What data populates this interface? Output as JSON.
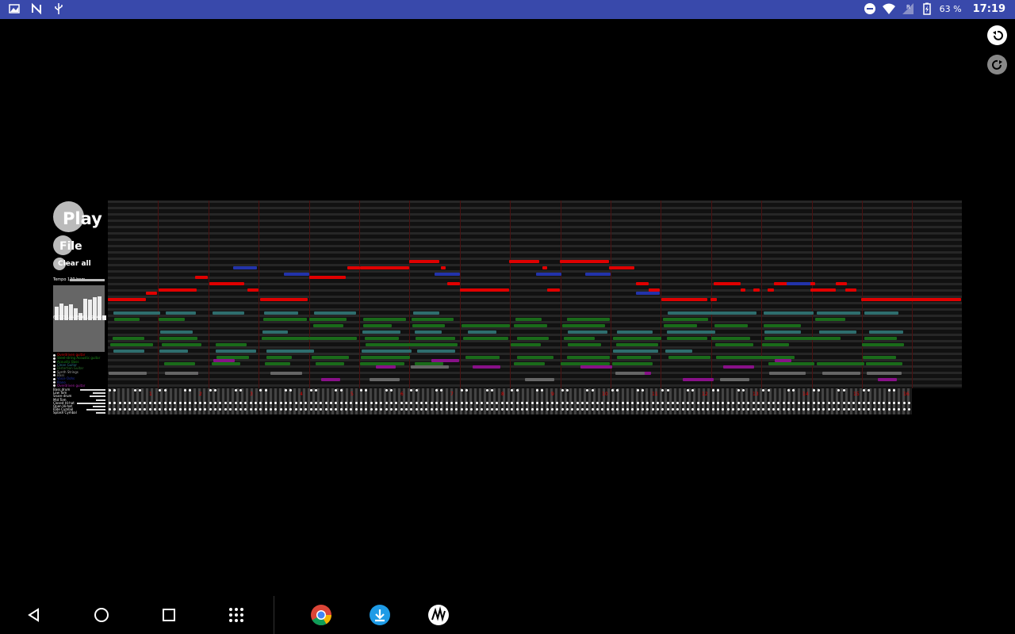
{
  "status_bar": {
    "time": "17:19",
    "battery": "63 %",
    "left_icons": [
      "image-icon",
      "n-icon",
      "usb-icon"
    ],
    "right_icons": [
      "dnd-icon",
      "wifi-icon",
      "signal-icon",
      "battery-icon"
    ]
  },
  "toolbar": {
    "play_label": "Play",
    "file_label": "File",
    "clear_label": "Clear all",
    "undo_icon": "undo-icon",
    "redo_icon": "redo-icon"
  },
  "tempo": {
    "label": "Tempo 130 bpm",
    "ticks": "65 123 144 28 46 1k 2k 4k 8k 16",
    "bar_levels": [
      0.55,
      0.7,
      0.6,
      0.65,
      0.5,
      0.3,
      0.9,
      0.85,
      0.95,
      1.0,
      0.2
    ]
  },
  "tracks": [
    {
      "name": "Overdriven guitar",
      "color": "#e00000"
    },
    {
      "name": "Steel-string Acoustic guitar",
      "color": "#1a8f1a"
    },
    {
      "name": "Acoustic Bass",
      "color": "#1a8f1a"
    },
    {
      "name": "Clean Guitar",
      "color": "#2e7a8a"
    },
    {
      "name": "Distortion Guitar",
      "color": "#2e7a2e"
    },
    {
      "name": "Synth Strings",
      "color": "#aaaaaa"
    },
    {
      "name": "Bass",
      "color": "#888888"
    },
    {
      "name": "Voice Oohs",
      "color": "#2233aa"
    },
    {
      "name": "Piano",
      "color": "#2233aa"
    },
    {
      "name": "Overdriven guitar",
      "color": "#aa22aa"
    }
  ],
  "drums": [
    {
      "name": "Bass drum",
      "level": 0.8
    },
    {
      "name": "Low Tom",
      "level": 0.4
    },
    {
      "name": "Snare drum",
      "level": 0.5
    },
    {
      "name": "Mid Tom",
      "level": 0.3
    },
    {
      "name": "Closed Hi-hat",
      "level": 0.9
    },
    {
      "name": "Open Hi-hat",
      "level": 0.4
    },
    {
      "name": "Ride Cymbal",
      "level": 0.6
    },
    {
      "name": "Splash Cymbal",
      "level": 0.3
    }
  ],
  "bar_numbers": [
    "1",
    "2",
    "3",
    "4",
    "5",
    "6",
    "7",
    "8",
    "9",
    "10",
    "11",
    "12",
    "13",
    "14",
    "15",
    "16"
  ],
  "nav": {
    "back_icon": "back-icon",
    "home_icon": "home-icon",
    "recents_icon": "recents-icon",
    "apps_icon": "apps-grid-icon",
    "apps": [
      "chrome-icon",
      "download-icon",
      "music-app-icon"
    ]
  },
  "colors": {
    "status_bar": "#3949ab",
    "melody": "#e00000",
    "harmony_green": "#1a6b1a",
    "blue": "#2233aa",
    "purple": "#881188"
  }
}
